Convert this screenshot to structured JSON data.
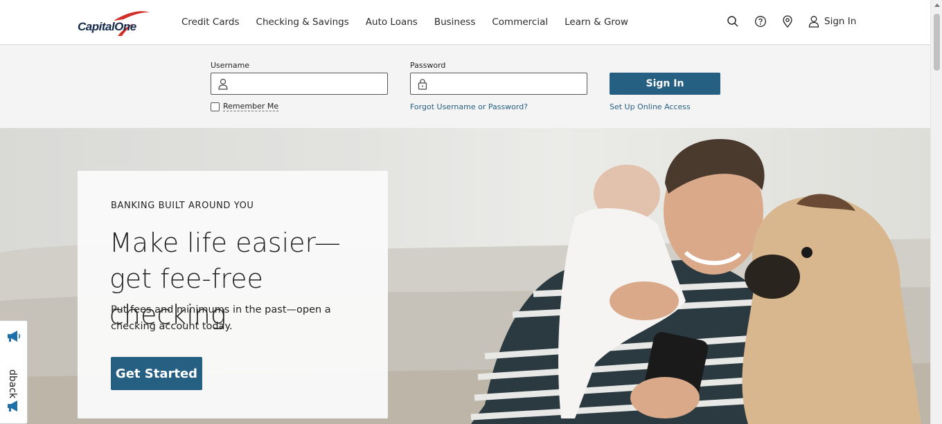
{
  "brand": {
    "logo_text": "CapitalOne",
    "accent": "#d03027",
    "navy": "#13294b",
    "button_color": "#255f82"
  },
  "nav": {
    "items": [
      "Credit Cards",
      "Checking & Savings",
      "Auto Loans",
      "Business",
      "Commercial",
      "Learn & Grow"
    ]
  },
  "utility": {
    "icons": [
      "search-icon",
      "help-icon",
      "location-icon",
      "user-icon"
    ],
    "sign_in_label": "Sign In"
  },
  "login": {
    "username_label": "Username",
    "password_label": "Password",
    "username_value": "",
    "password_value": "",
    "remember_me_label": "Remember Me",
    "remember_me_checked": false,
    "forgot_link": "Forgot Username or Password?",
    "sign_in_button": "Sign In",
    "setup_link": "Set Up Online Access"
  },
  "hero": {
    "eyebrow": "BANKING BUILT AROUND YOU",
    "headline": "Make life easier—get fee-free checking",
    "subtext": "Put fees and minimums in the past—open a checking account today.",
    "cta_label": "Get Started"
  },
  "feedback": {
    "label": "dback"
  }
}
